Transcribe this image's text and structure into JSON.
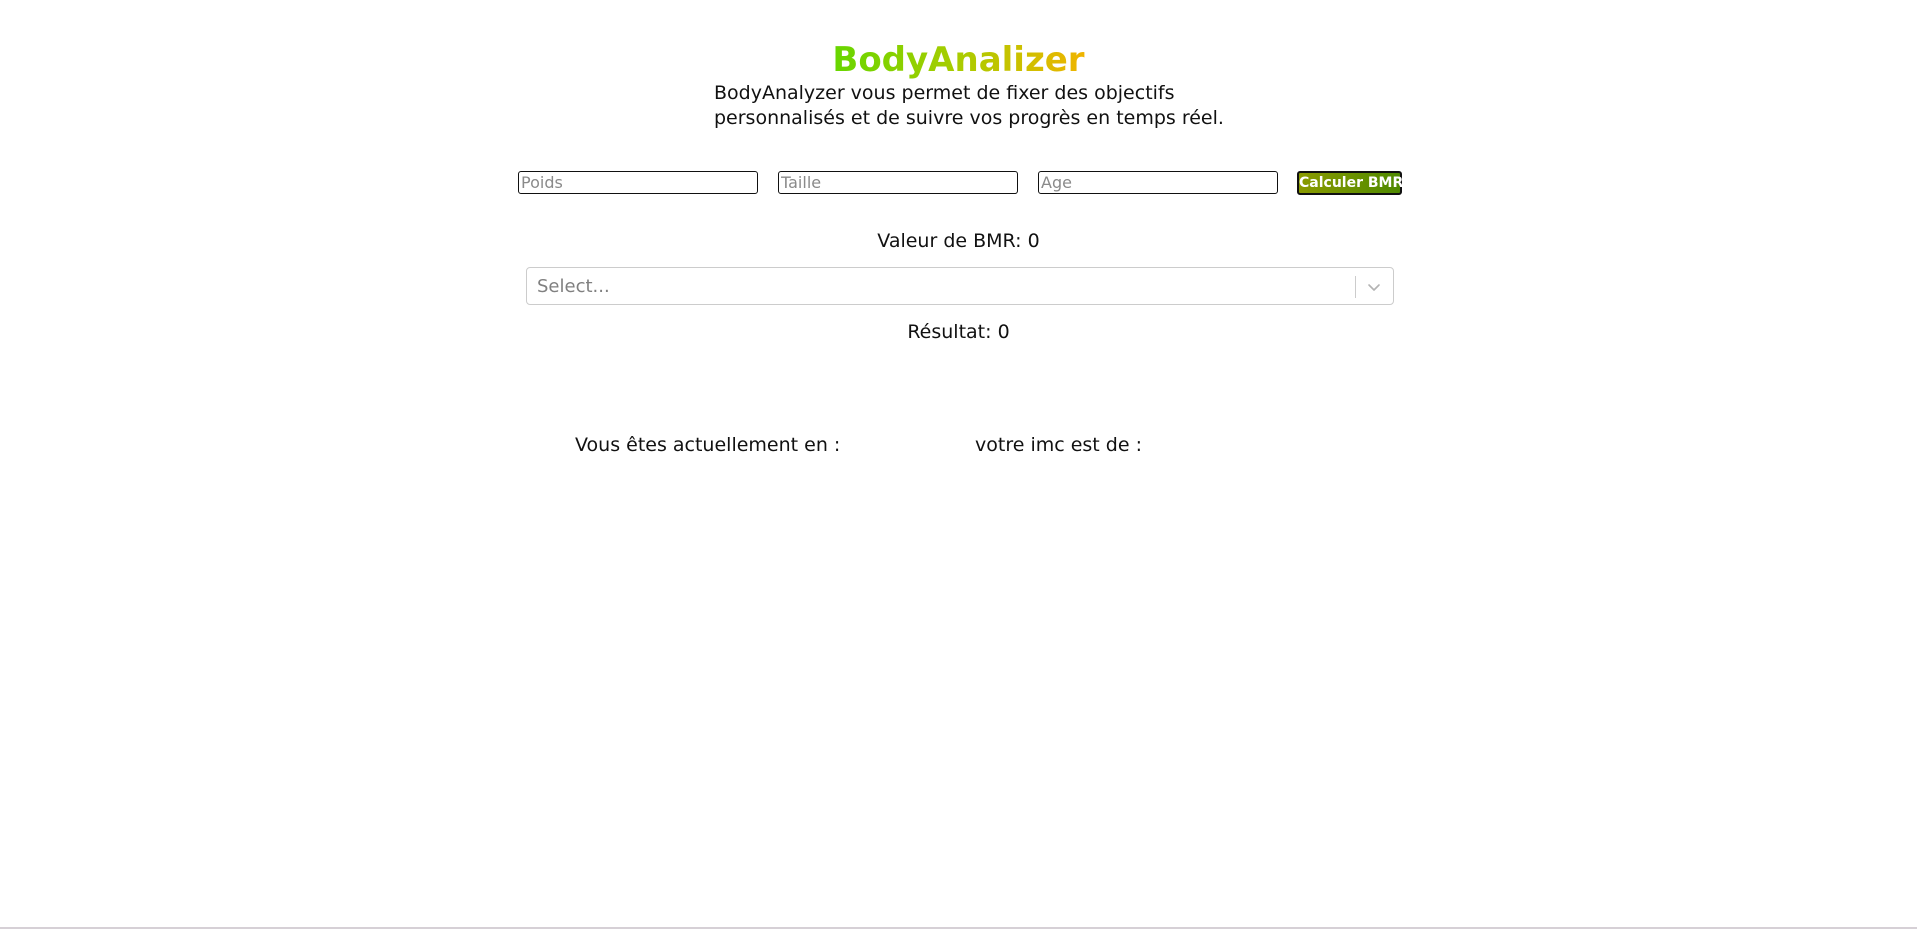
{
  "app": {
    "title": "BodyAnalizer",
    "description": "BodyAnalyzer vous permet de fixer des objectifs personnalisés et de suivre vos progrès en temps réel."
  },
  "form": {
    "weight_placeholder": "Poids",
    "height_placeholder": "Taille",
    "age_placeholder": "Age",
    "calculate_label": "Calculer BMR"
  },
  "bmr": {
    "text": "Valeur de BMR: 0"
  },
  "activity_select": {
    "placeholder": "Select...",
    "icon": "chevron-down-icon"
  },
  "result": {
    "text": "Résultat: 0"
  },
  "status": {
    "current_state_label": "Vous êtes actuellement en :",
    "imc_label": "votre imc est de :"
  },
  "colors": {
    "title_gradient_start": "#66d600",
    "title_gradient_end": "#f0b400",
    "button_gradient_start": "#8a9a00",
    "button_gradient_end": "#4f8a00"
  }
}
